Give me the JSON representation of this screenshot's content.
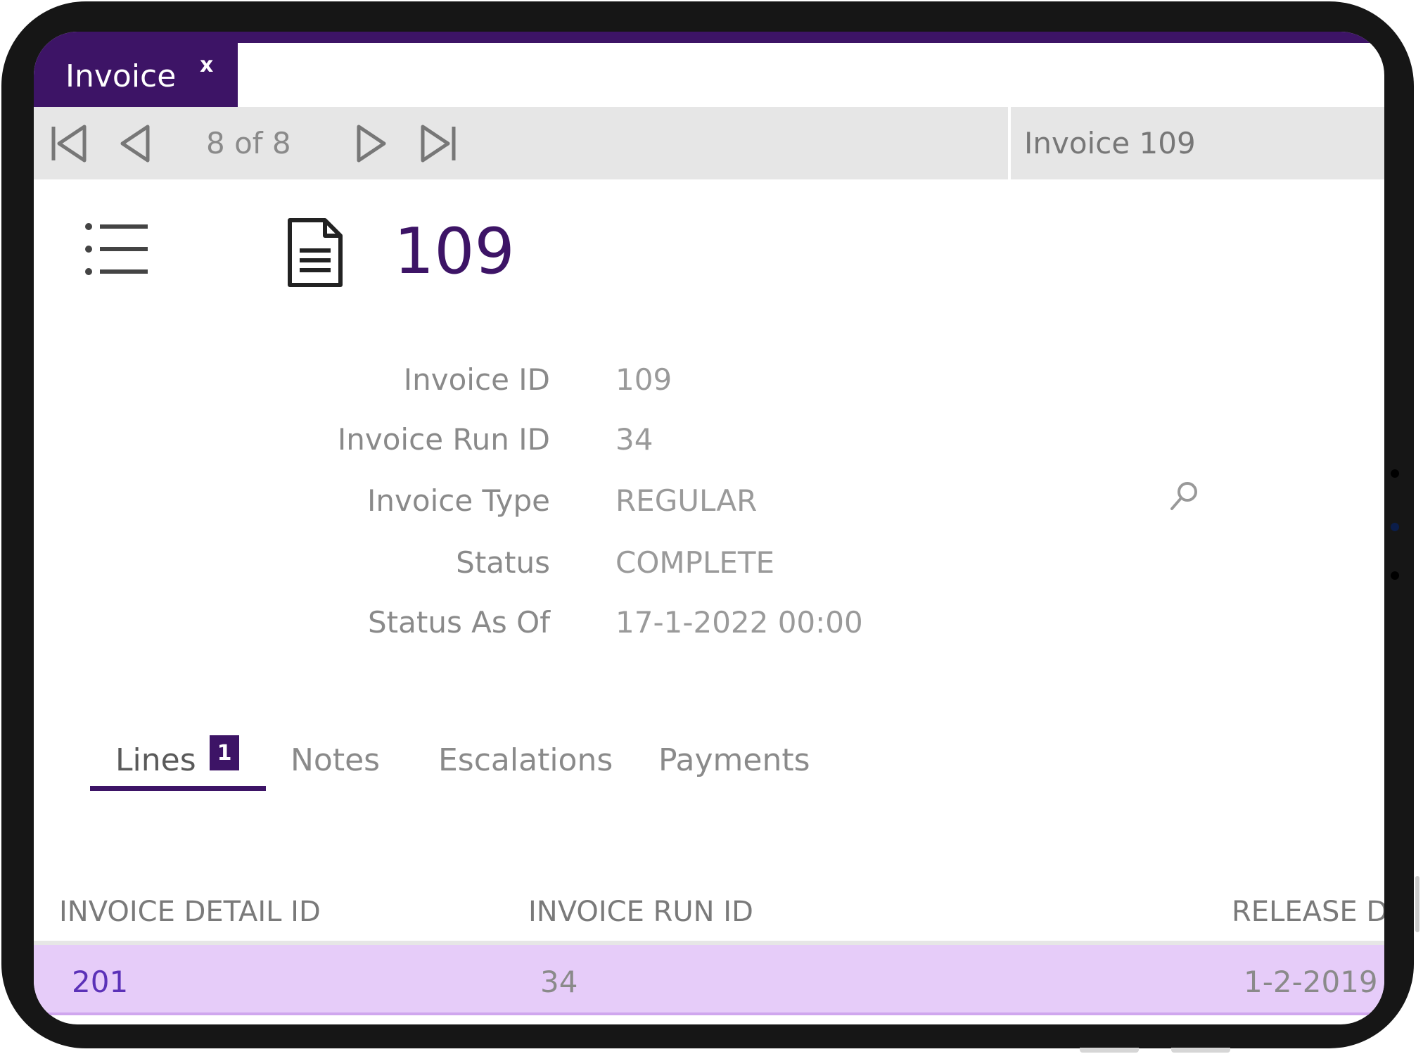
{
  "app": {
    "tab": {
      "label": "Invoice",
      "close_label": "x"
    }
  },
  "toolbar": {
    "pager": "8 of 8",
    "record_title": "Invoice 109",
    "icons": [
      "first-page-icon",
      "previous-icon",
      "next-icon",
      "last-page-icon"
    ]
  },
  "header": {
    "record_id": "109",
    "icons": [
      "list-icon",
      "document-icon"
    ]
  },
  "fields": [
    {
      "label": "Invoice ID",
      "value": "109"
    },
    {
      "label": "Invoice Run ID",
      "value": "34"
    },
    {
      "label": "Invoice Type",
      "value": "REGULAR"
    },
    {
      "label": "Status",
      "value": "COMPLETE"
    },
    {
      "label": "Status As Of",
      "value": "17-1-2022 00:00"
    }
  ],
  "subtabs": [
    {
      "label": "Lines",
      "badge": "1"
    },
    {
      "label": "Notes"
    },
    {
      "label": "Escalations"
    },
    {
      "label": "Payments"
    }
  ],
  "table": {
    "columns": [
      "INVOICE DETAIL ID",
      "INVOICE RUN ID",
      "RELEASE D"
    ],
    "rows": [
      [
        "201",
        "34",
        "1-2-2019"
      ]
    ]
  },
  "colors": {
    "accent": "#3d1466",
    "selected_row": "#e6ccf9",
    "link": "#5b31b8"
  }
}
